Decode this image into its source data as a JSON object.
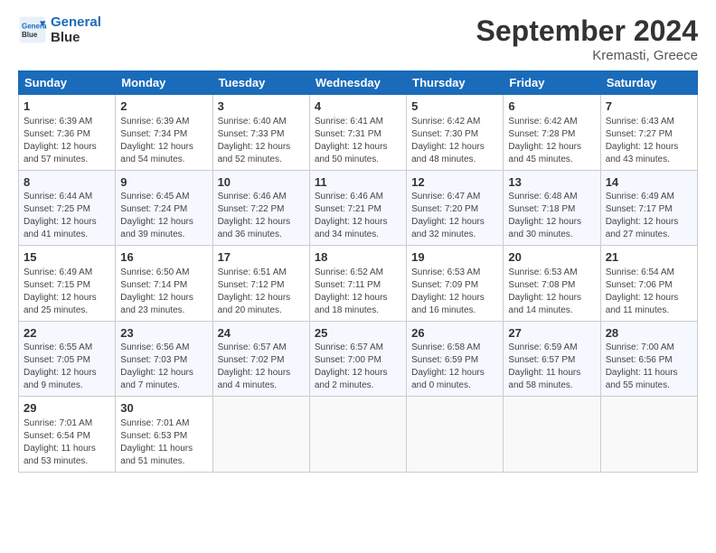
{
  "header": {
    "logo_line1": "General",
    "logo_line2": "Blue",
    "month": "September 2024",
    "location": "Kremasti, Greece"
  },
  "days_of_week": [
    "Sunday",
    "Monday",
    "Tuesday",
    "Wednesday",
    "Thursday",
    "Friday",
    "Saturday"
  ],
  "weeks": [
    [
      {
        "day": "1",
        "info": "Sunrise: 6:39 AM\nSunset: 7:36 PM\nDaylight: 12 hours\nand 57 minutes."
      },
      {
        "day": "2",
        "info": "Sunrise: 6:39 AM\nSunset: 7:34 PM\nDaylight: 12 hours\nand 54 minutes."
      },
      {
        "day": "3",
        "info": "Sunrise: 6:40 AM\nSunset: 7:33 PM\nDaylight: 12 hours\nand 52 minutes."
      },
      {
        "day": "4",
        "info": "Sunrise: 6:41 AM\nSunset: 7:31 PM\nDaylight: 12 hours\nand 50 minutes."
      },
      {
        "day": "5",
        "info": "Sunrise: 6:42 AM\nSunset: 7:30 PM\nDaylight: 12 hours\nand 48 minutes."
      },
      {
        "day": "6",
        "info": "Sunrise: 6:42 AM\nSunset: 7:28 PM\nDaylight: 12 hours\nand 45 minutes."
      },
      {
        "day": "7",
        "info": "Sunrise: 6:43 AM\nSunset: 7:27 PM\nDaylight: 12 hours\nand 43 minutes."
      }
    ],
    [
      {
        "day": "8",
        "info": "Sunrise: 6:44 AM\nSunset: 7:25 PM\nDaylight: 12 hours\nand 41 minutes."
      },
      {
        "day": "9",
        "info": "Sunrise: 6:45 AM\nSunset: 7:24 PM\nDaylight: 12 hours\nand 39 minutes."
      },
      {
        "day": "10",
        "info": "Sunrise: 6:46 AM\nSunset: 7:22 PM\nDaylight: 12 hours\nand 36 minutes."
      },
      {
        "day": "11",
        "info": "Sunrise: 6:46 AM\nSunset: 7:21 PM\nDaylight: 12 hours\nand 34 minutes."
      },
      {
        "day": "12",
        "info": "Sunrise: 6:47 AM\nSunset: 7:20 PM\nDaylight: 12 hours\nand 32 minutes."
      },
      {
        "day": "13",
        "info": "Sunrise: 6:48 AM\nSunset: 7:18 PM\nDaylight: 12 hours\nand 30 minutes."
      },
      {
        "day": "14",
        "info": "Sunrise: 6:49 AM\nSunset: 7:17 PM\nDaylight: 12 hours\nand 27 minutes."
      }
    ],
    [
      {
        "day": "15",
        "info": "Sunrise: 6:49 AM\nSunset: 7:15 PM\nDaylight: 12 hours\nand 25 minutes."
      },
      {
        "day": "16",
        "info": "Sunrise: 6:50 AM\nSunset: 7:14 PM\nDaylight: 12 hours\nand 23 minutes."
      },
      {
        "day": "17",
        "info": "Sunrise: 6:51 AM\nSunset: 7:12 PM\nDaylight: 12 hours\nand 20 minutes."
      },
      {
        "day": "18",
        "info": "Sunrise: 6:52 AM\nSunset: 7:11 PM\nDaylight: 12 hours\nand 18 minutes."
      },
      {
        "day": "19",
        "info": "Sunrise: 6:53 AM\nSunset: 7:09 PM\nDaylight: 12 hours\nand 16 minutes."
      },
      {
        "day": "20",
        "info": "Sunrise: 6:53 AM\nSunset: 7:08 PM\nDaylight: 12 hours\nand 14 minutes."
      },
      {
        "day": "21",
        "info": "Sunrise: 6:54 AM\nSunset: 7:06 PM\nDaylight: 12 hours\nand 11 minutes."
      }
    ],
    [
      {
        "day": "22",
        "info": "Sunrise: 6:55 AM\nSunset: 7:05 PM\nDaylight: 12 hours\nand 9 minutes."
      },
      {
        "day": "23",
        "info": "Sunrise: 6:56 AM\nSunset: 7:03 PM\nDaylight: 12 hours\nand 7 minutes."
      },
      {
        "day": "24",
        "info": "Sunrise: 6:57 AM\nSunset: 7:02 PM\nDaylight: 12 hours\nand 4 minutes."
      },
      {
        "day": "25",
        "info": "Sunrise: 6:57 AM\nSunset: 7:00 PM\nDaylight: 12 hours\nand 2 minutes."
      },
      {
        "day": "26",
        "info": "Sunrise: 6:58 AM\nSunset: 6:59 PM\nDaylight: 12 hours\nand 0 minutes."
      },
      {
        "day": "27",
        "info": "Sunrise: 6:59 AM\nSunset: 6:57 PM\nDaylight: 11 hours\nand 58 minutes."
      },
      {
        "day": "28",
        "info": "Sunrise: 7:00 AM\nSunset: 6:56 PM\nDaylight: 11 hours\nand 55 minutes."
      }
    ],
    [
      {
        "day": "29",
        "info": "Sunrise: 7:01 AM\nSunset: 6:54 PM\nDaylight: 11 hours\nand 53 minutes."
      },
      {
        "day": "30",
        "info": "Sunrise: 7:01 AM\nSunset: 6:53 PM\nDaylight: 11 hours\nand 51 minutes."
      },
      {
        "day": "",
        "info": ""
      },
      {
        "day": "",
        "info": ""
      },
      {
        "day": "",
        "info": ""
      },
      {
        "day": "",
        "info": ""
      },
      {
        "day": "",
        "info": ""
      }
    ]
  ]
}
